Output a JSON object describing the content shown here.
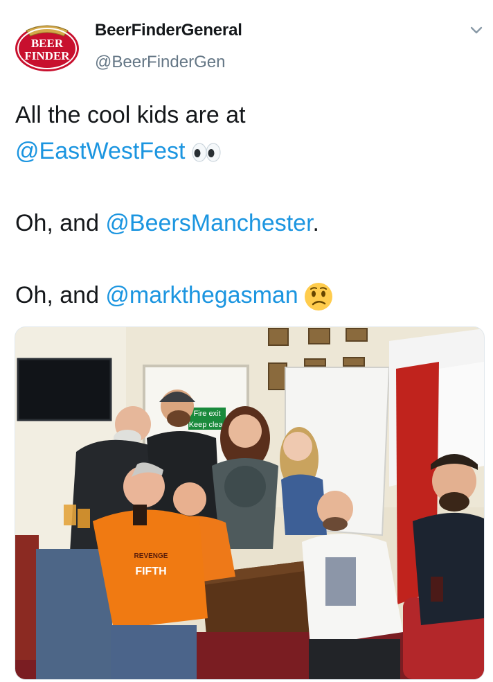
{
  "tweet": {
    "author": {
      "display_name": "BeerFinderGeneral",
      "handle": "@BeerFinderGen",
      "avatar_text": [
        "BEER",
        "FINDER"
      ]
    },
    "menu_icon": "chevron-down-icon",
    "lines": [
      {
        "text": "All the cool kids are at "
      },
      {
        "mention": "@EastWestFest",
        "emoji": "eyes"
      },
      {
        "text": "Oh, and ",
        "mention": "@BeersManchester",
        "after": "."
      },
      {
        "text": "Oh, and ",
        "mention": "@markthegasman",
        "emoji": "confused-face"
      }
    ],
    "photo": {
      "signs": [
        "Fire exit",
        "Keep clear"
      ],
      "shirt_text": [
        "REVENGE",
        "FIFTH"
      ]
    }
  }
}
